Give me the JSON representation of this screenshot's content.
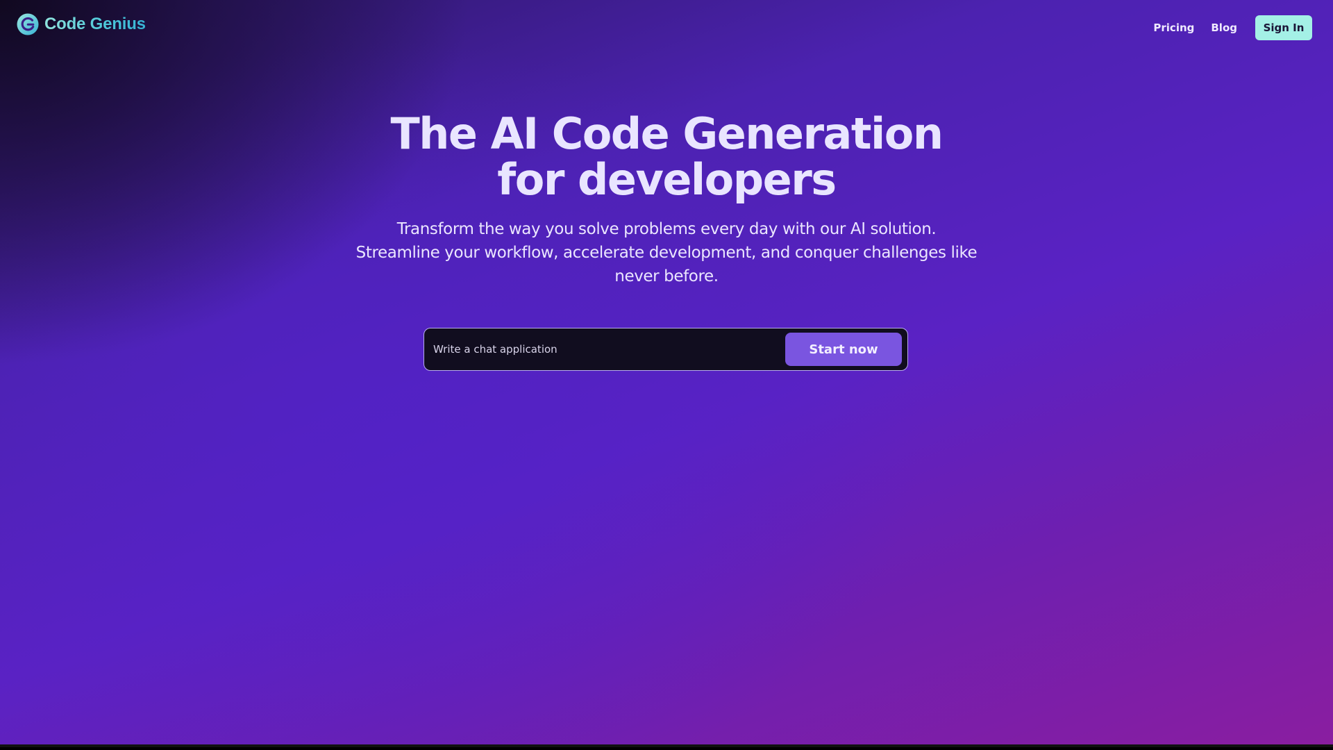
{
  "header": {
    "brand": "Code Genius",
    "logo_icon": "code-genius-logo-icon",
    "nav": {
      "pricing_label": "Pricing",
      "blog_label": "Blog",
      "signin_label": "Sign In"
    }
  },
  "hero": {
    "title_line1": "The AI Code Generation",
    "title_line2": "for developers",
    "subtitle": "Transform the way you solve problems every day with our AI solution. Streamline your workflow, accelerate development, and conquer challenges like never before."
  },
  "prompt": {
    "placeholder": "Write a chat application",
    "value": "",
    "button_label": "Start now"
  },
  "colors": {
    "brand_gradient_start": "#8fe3dd",
    "brand_gradient_end": "#37b2d4",
    "signin_bg": "#a4f0e6",
    "start_button_bg": "#7a55e0",
    "input_bg": "#110d1f"
  }
}
